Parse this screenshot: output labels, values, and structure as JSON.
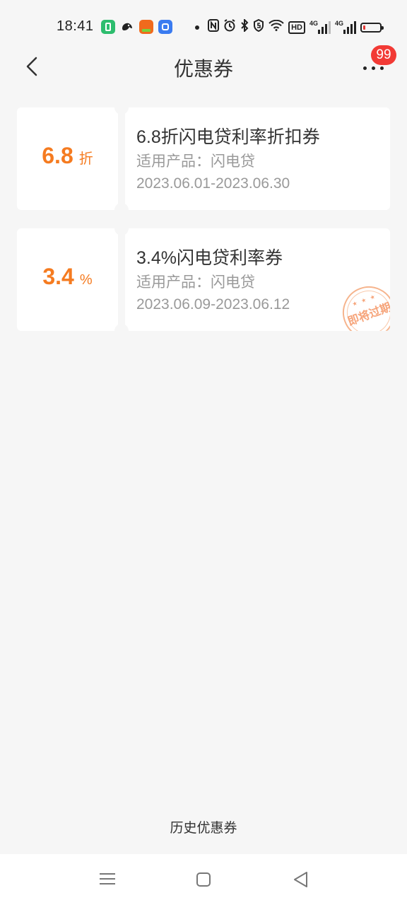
{
  "status_bar": {
    "time": "18:41",
    "icons": [
      "battery-saver-icon",
      "bird-app-icon",
      "orange-app-icon",
      "blue-app-icon",
      "dot-icon",
      "nfc-icon",
      "alarm-icon",
      "bluetooth-icon",
      "shield-icon",
      "wifi-icon",
      "hd-icon",
      "signal-4g-icon",
      "signal-4g-icon",
      "battery-icon"
    ],
    "hd_label": "HD",
    "network_label_1": "4G",
    "network_label_2": "4G",
    "battery_color": "#e53935"
  },
  "header": {
    "title": "优惠券",
    "back_icon": "chevron-left-icon",
    "more_icon": "more-horizontal-icon",
    "badge_count": "99",
    "badge_color": "#f23a35"
  },
  "coupons": [
    {
      "value": "6.8",
      "unit": "折",
      "title": "6.8折闪电贷利率折扣券",
      "product": "适用产品：闪电贷",
      "validity": "2023.06.01-2023.06.30"
    },
    {
      "value": "3.4",
      "unit": "%",
      "title": "3.4%闪电贷利率券",
      "product": "适用产品：闪电贷",
      "validity": "2023.06.09-2023.06.12",
      "stamp": "即将过期",
      "stamp_stars": "★ ★ ★"
    }
  ],
  "accent_color": "#f57b20",
  "history_link": "历史优惠券",
  "nav_bar": {
    "icons": [
      "menu-icon",
      "home-square-icon",
      "back-triangle-icon"
    ]
  }
}
